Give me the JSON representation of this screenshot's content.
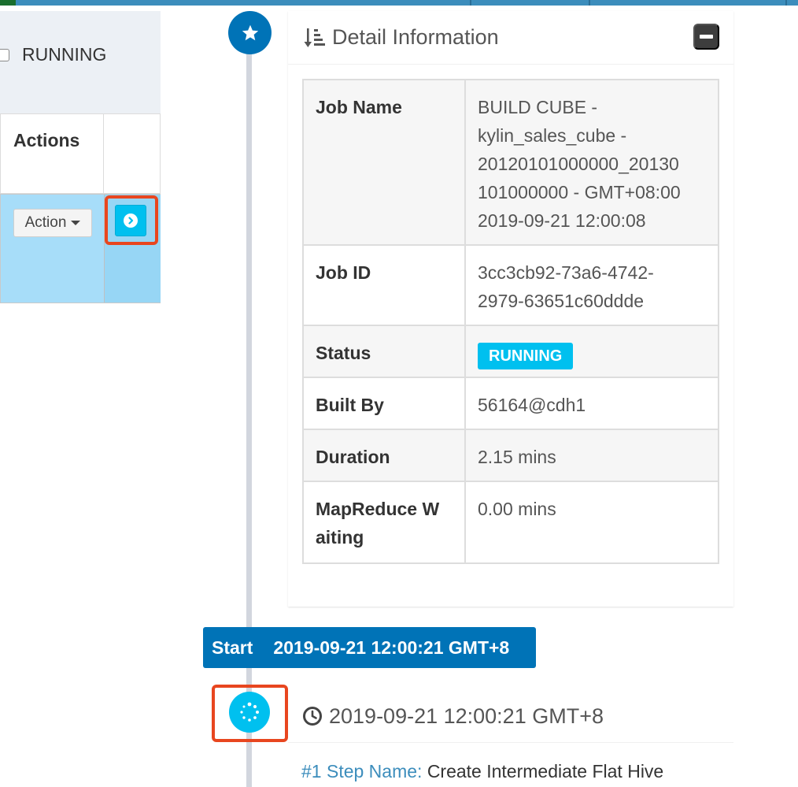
{
  "filter": {
    "label": "RUNNING"
  },
  "jobs_table": {
    "header": {
      "actions_label": "Actions"
    },
    "row": {
      "action_button_label": "Action"
    }
  },
  "detail": {
    "title": "Detail Information",
    "rows": [
      {
        "key": "Job Name",
        "value_lines": [
          "BUILD CUBE -",
          "kylin_sales_cube -",
          "20120101000000_20130",
          "101000000 - GMT+08:00",
          "2019-09-21 12:00:08"
        ]
      },
      {
        "key": "Job ID",
        "value_lines": [
          "3cc3cb92-73a6-4742-",
          "2979-63651c60ddde"
        ]
      },
      {
        "key": "Status",
        "badge": "RUNNING"
      },
      {
        "key": "Built By",
        "value_lines": [
          "56164@cdh1"
        ]
      },
      {
        "key": "Duration",
        "value_lines": [
          "2.15 mins"
        ]
      },
      {
        "key_lines": [
          "MapReduce W",
          "aiting"
        ],
        "value_lines": [
          "0.00 mins"
        ]
      }
    ]
  },
  "timeline": {
    "start_label": "Start",
    "start_time": "2019-09-21 12:00:21 GMT+8",
    "step": {
      "time": "2019-09-21 12:00:21 GMT+8",
      "name_key": "#1 Step Name:",
      "name_value": "Create Intermediate Flat Hive"
    }
  },
  "icons": {
    "star": "star-icon",
    "sort": "sort-amount-icon",
    "collapse": "minus-square-icon",
    "open_detail": "chevron-circle-right-icon",
    "step_status": "spinner-icon",
    "clock": "clock-icon"
  },
  "colors": {
    "primary": "#0073b7",
    "info": "#00c0ef",
    "highlight": "#e8461f",
    "selected_row": "#a7ddf9"
  }
}
